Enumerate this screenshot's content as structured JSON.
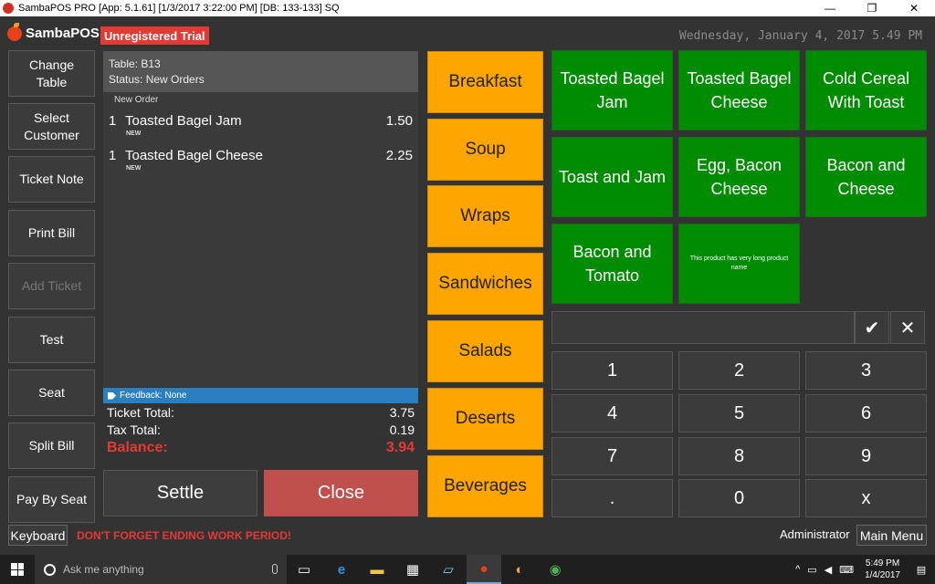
{
  "window": {
    "title": "SambaPOS PRO [App: 5.1.61] [1/3/2017 3:22:00 PM] [DB: 133-133] SQ",
    "controls": [
      "—",
      "❐",
      "✕"
    ]
  },
  "header": {
    "logo_text": "SambaPOS",
    "trial_badge": "Unregistered Trial",
    "datetime": "Wednesday, January 4, 2017 5.49 PM"
  },
  "left_buttons": [
    {
      "label": "Change Table",
      "enabled": true
    },
    {
      "label": "Select Customer",
      "enabled": true
    },
    {
      "label": "Ticket Note",
      "enabled": true
    },
    {
      "label": "Print Bill",
      "enabled": true
    },
    {
      "label": "Add Ticket",
      "enabled": false
    },
    {
      "label": "Test",
      "enabled": true
    },
    {
      "label": "Seat",
      "enabled": true
    },
    {
      "label": "Split Bill",
      "enabled": true
    },
    {
      "label": "Pay By Seat",
      "enabled": true
    }
  ],
  "ticket": {
    "table": "Table: B13",
    "status": "Status: New Orders",
    "order_group": "New Order",
    "orders": [
      {
        "qty": "1",
        "name": "Toasted Bagel Jam",
        "price": "1.50",
        "tag": "NEW"
      },
      {
        "qty": "1",
        "name": "Toasted Bagel Cheese",
        "price": "2.25",
        "tag": "NEW"
      }
    ],
    "feedback": "Feedback: None",
    "ticket_total_label": "Ticket Total:",
    "ticket_total": "3.75",
    "tax_total_label": "Tax Total:",
    "tax_total": "0.19",
    "balance_label": "Balance:",
    "balance": "3.94",
    "settle_label": "Settle",
    "close_label": "Close"
  },
  "categories": [
    "Breakfast",
    "Soup",
    "Wraps",
    "Sandwiches",
    "Salads",
    "Deserts",
    "Beverages"
  ],
  "products": [
    "Toasted Bagel Jam",
    "Toasted Bagel Cheese",
    "Cold Cereal With Toast",
    "Toast and Jam",
    "Egg, Bacon Cheese",
    "Bacon and Cheese",
    "Bacon and Tomato",
    "This product has very long product name"
  ],
  "numpad": {
    "ok_symbol": "✔",
    "clear_symbol": "✕",
    "keys": [
      "1",
      "2",
      "3",
      "4",
      "5",
      "6",
      "7",
      "8",
      "9",
      ".",
      "0",
      "x"
    ]
  },
  "footer": {
    "keyboard_label": "Keyboard",
    "warning": "DON'T FORGET ENDING WORK PERIOD!",
    "user": "Administrator",
    "main_menu_label": "Main Menu"
  },
  "taskbar": {
    "search_placeholder": "Ask me anything",
    "time": "5:49 PM",
    "date": "1/4/2017"
  },
  "colors": {
    "category": "#ffa500",
    "product": "#008c00",
    "close": "#c0504d",
    "balance": "#e53935",
    "feedback": "#2a7fc0"
  }
}
